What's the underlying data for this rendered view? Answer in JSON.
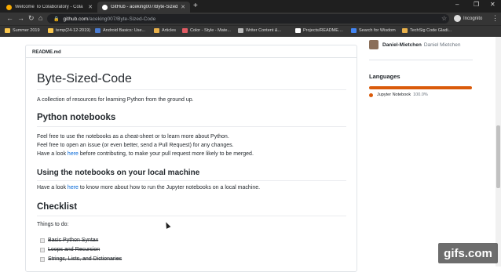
{
  "tabs": [
    {
      "title": "Welcome To Colaboratory - Cola",
      "favicon_color": "#f9ab00"
    },
    {
      "title": "GitHub - aceking007/Byte-Sized-",
      "favicon_color": "#ffffff"
    }
  ],
  "new_tab_label": "+",
  "window_controls": {
    "minimize": "–",
    "maximize": "❐",
    "close": "✕"
  },
  "nav": {
    "back": "←",
    "forward": "→",
    "reload": "↻",
    "home": "⌂"
  },
  "omnibox": {
    "host": "github.com",
    "path": "/aceking007/Byte-Sized-Code",
    "lock": "🔒"
  },
  "incognito_label": "Incognito",
  "bookmarks": [
    {
      "label": "Summer 2019",
      "color": "#f9c74f"
    },
    {
      "label": "temp(24-12-2019)",
      "color": "#f9c74f"
    },
    {
      "label": "Android Basics: Use...",
      "color": "#4a7bd0"
    },
    {
      "label": "Articles",
      "color": "#e8b04a"
    },
    {
      "label": "Color - Style - Mate...",
      "color": "#e15b64"
    },
    {
      "label": "Writer Content &...",
      "color": "#bbbbbb"
    },
    {
      "label": "Projects/README....",
      "color": "#ffffff"
    },
    {
      "label": "Search for Wisdom",
      "color": "#4285f4"
    },
    {
      "label": "TechSig Code Gladi...",
      "color": "#e8b04a"
    }
  ],
  "readme": {
    "filename": "README.md",
    "title": "Byte-Sized-Code",
    "intro": "A collection of resources for learning Python from the ground up.",
    "h_notebooks": "Python notebooks",
    "nb_line1": "Feel free to use the notebooks as a cheat-sheet or to learn more about Python.",
    "nb_line2": "Feel free to open an issue (or even better, send a Pull Request) for any changes.",
    "nb_line3_pre": "Have a look ",
    "nb_line3_link": "here",
    "nb_line3_post": " before contributing, to make your pull request more likely to be merged.",
    "h_local": "Using the notebooks on your local machine",
    "local_pre": "Have a look ",
    "local_link": "here",
    "local_post": " to know more about how to run the Jupyter notebooks on a local machine.",
    "h_checklist": "Checklist",
    "todo": "Things to do:",
    "checklist": [
      "Basic Python Syntax",
      "Loops and Recursion",
      "Strings, Lists, and Dictionaries"
    ]
  },
  "sidebar": {
    "author_login": "Daniel-Mietchen",
    "author_name": "Daniel Mietchen",
    "languages_title": "Languages",
    "language": "Jupyter Notebook",
    "language_pct": "100.0%",
    "language_color": "#da5b0b"
  },
  "watermark": "gifs.com"
}
